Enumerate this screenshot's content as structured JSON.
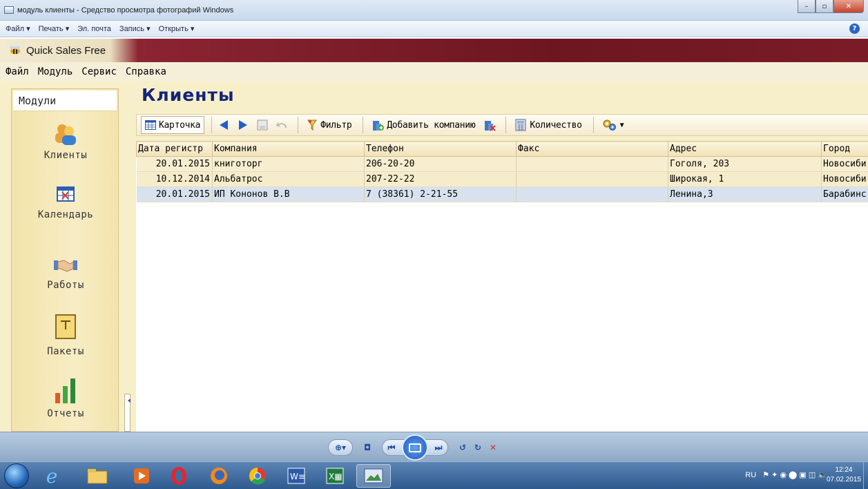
{
  "viewer": {
    "title": "модуль клиенты - Средство просмотра фотографий Windows",
    "menu": [
      "Файл ▾",
      "Печать ▾",
      "Эл. почта",
      "Запись ▾",
      "Открыть ▾"
    ],
    "help": "?"
  },
  "app": {
    "title": "Quick Sales Free",
    "menu": [
      "Файл",
      "Модуль",
      "Сервис",
      "Справка"
    ]
  },
  "modules": {
    "header": "Модули",
    "items": [
      {
        "label": "Клиенты",
        "icon": "clients-icon"
      },
      {
        "label": "Календарь",
        "icon": "calendar-icon"
      },
      {
        "label": "Работы",
        "icon": "handshake-icon"
      },
      {
        "label": "Пакеты",
        "icon": "package-icon"
      },
      {
        "label": "Отчеты",
        "icon": "bar-chart-icon"
      }
    ]
  },
  "main": {
    "title": "Клиенты",
    "toolbar": {
      "card": "Карточка",
      "filter": "Фильтр",
      "add_company": "Добавить компанию",
      "count": "Количество"
    },
    "table": {
      "columns": [
        "Дата регистр",
        "Компания",
        "Телефон",
        "Факс",
        "Адрес",
        "Город"
      ],
      "rows": [
        [
          "20.01.2015",
          "книготорг",
          "206-20-20",
          "",
          "Гоголя, 203",
          "Новосиби"
        ],
        [
          "10.12.2014",
          "Альбатрос",
          "207-22-22",
          "",
          "Широкая, 1",
          "Новосиби"
        ],
        [
          "20.01.2015",
          "ИП Кононов В.В",
          "7 (38361) 2-21-55",
          "",
          "Ленина,3",
          "Барабинс"
        ]
      ]
    }
  },
  "taskbar": {
    "lang": "RU",
    "time": "12:24",
    "date": "07.02.2015"
  },
  "colors": {
    "title_blue": "#13247a",
    "panel_cream": "#f7efc9",
    "header_maroon": "#6d1621",
    "selected_row": "#d8e2ef"
  }
}
